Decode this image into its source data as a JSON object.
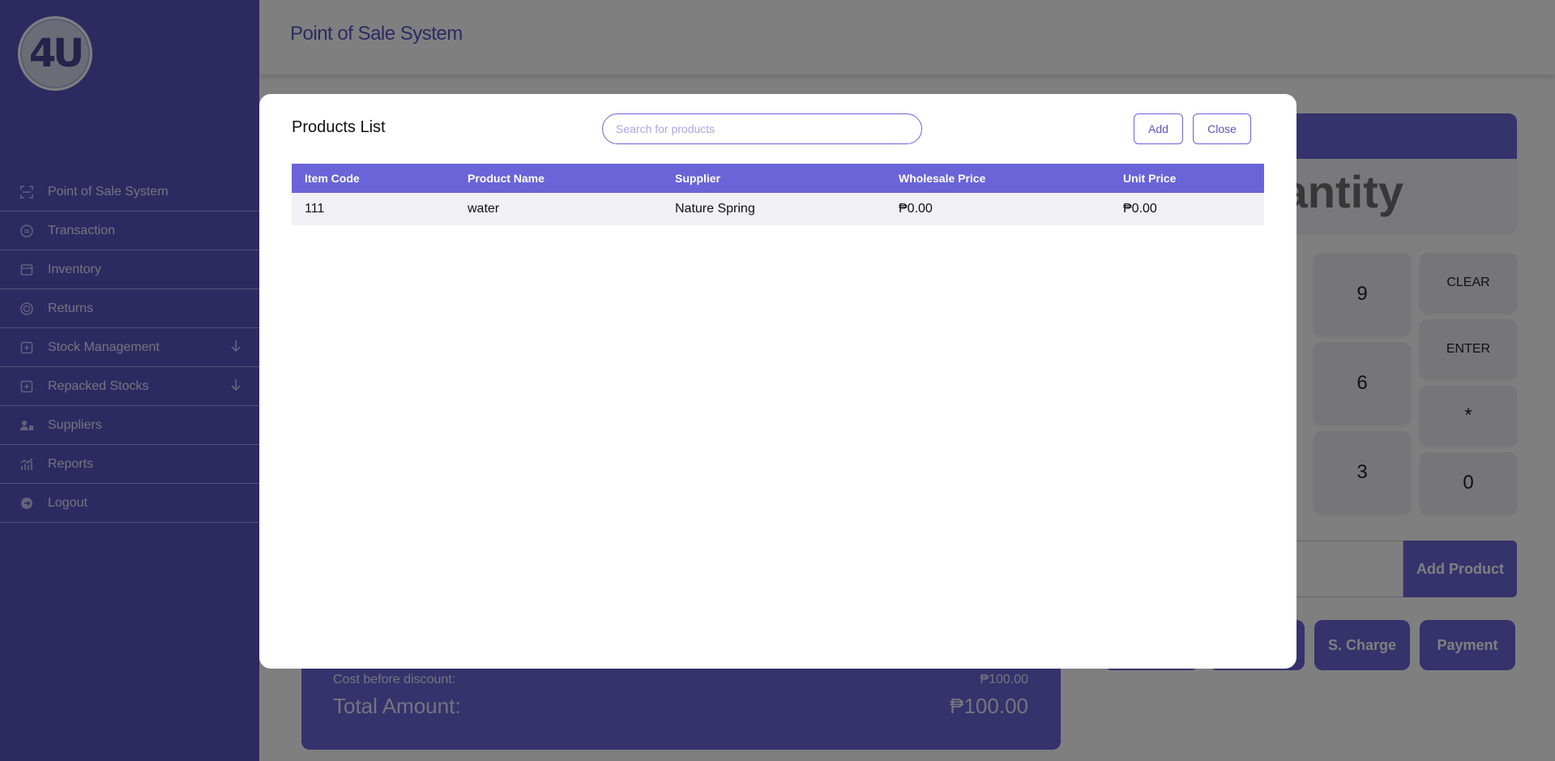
{
  "app": {
    "title": "Point of Sale System",
    "logo_text": "4U"
  },
  "sidebar": {
    "items": [
      {
        "label": "Point of Sale System",
        "icon": "pos-icon",
        "has_arrow": false
      },
      {
        "label": "Transaction",
        "icon": "transaction-icon",
        "has_arrow": false
      },
      {
        "label": "Inventory",
        "icon": "inventory-icon",
        "has_arrow": false
      },
      {
        "label": "Returns",
        "icon": "returns-icon",
        "has_arrow": false
      },
      {
        "label": "Stock Management",
        "icon": "stock-icon",
        "has_arrow": true
      },
      {
        "label": "Repacked Stocks",
        "icon": "repack-icon",
        "has_arrow": true
      },
      {
        "label": "Suppliers",
        "icon": "suppliers-icon",
        "has_arrow": false
      },
      {
        "label": "Reports",
        "icon": "reports-icon",
        "has_arrow": false
      },
      {
        "label": "Logout",
        "icon": "logout-icon",
        "has_arrow": false
      }
    ]
  },
  "background": {
    "quantity_label": "antity",
    "keys": {
      "k9": "9",
      "k6": "6",
      "k3": "3",
      "k0": "0",
      "clear": "CLEAR",
      "enter": "ENTER",
      "star": "*"
    },
    "add_product": "Add Product",
    "s_charge": "S. Charge",
    "payment": "Payment",
    "cost_before_discount_label": "Cost before discount:",
    "cost_before_discount_value": "₱100.00",
    "total_amount_label": "Total Amount:",
    "total_amount_value": "₱100.00"
  },
  "modal": {
    "title": "Products List",
    "search_placeholder": "Search for products",
    "add_label": "Add",
    "close_label": "Close",
    "columns": [
      "Item Code",
      "Product Name",
      "Supplier",
      "Wholesale Price",
      "Unit Price"
    ],
    "rows": [
      {
        "item_code": "111",
        "product_name": "water",
        "supplier": "Nature Spring",
        "wholesale_price": "₱0.00",
        "unit_price": "₱0.00"
      }
    ]
  },
  "colors": {
    "accent": "#6a64d8",
    "sidebar": "#5b55c4"
  }
}
